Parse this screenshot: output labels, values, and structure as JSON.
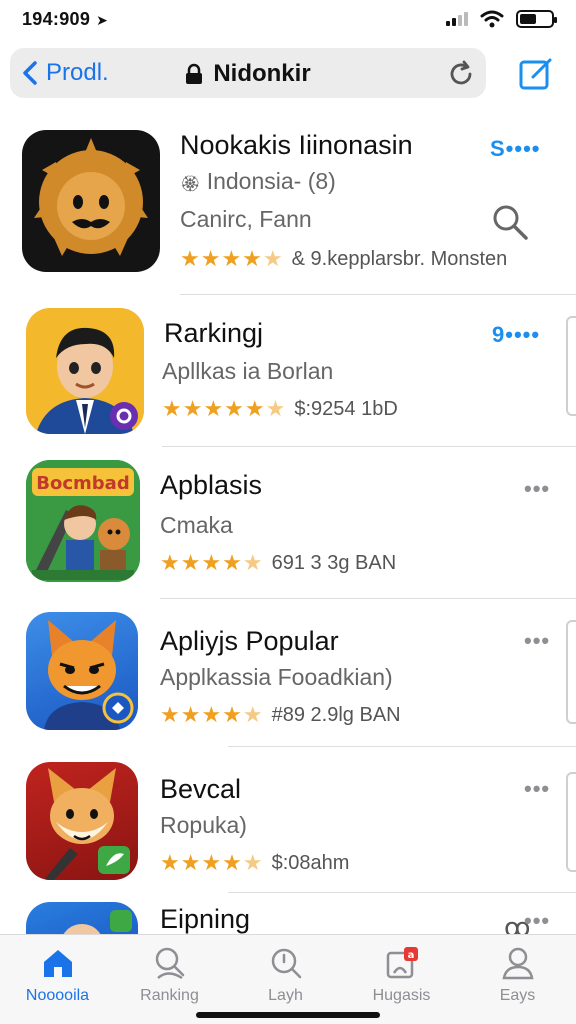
{
  "status_bar": {
    "time": "194:909",
    "location_arrow": "➤"
  },
  "nav": {
    "back_label": "Prodl.",
    "title": "Nidonkir",
    "lock_icon": "🔒"
  },
  "apps": [
    {
      "name": "Nookakis Iiinonasin",
      "subtitle": "Indonsia- (8)",
      "subtitle2": "Canirc, Fann",
      "rating_text": "& 9.kepplarsbr. Monsten",
      "more": "S••••"
    },
    {
      "name": "Rarkingj",
      "subtitle": "Apllkas ia Borlan",
      "rating_text": "$:9254 1bD",
      "more": "9••••"
    },
    {
      "name": "Apblasis",
      "subtitle": "Cmaka",
      "rating_text": "691 3 3g BAN",
      "more": "•••"
    },
    {
      "name": "Apliyjs Popular",
      "subtitle": "Applkassia Fooadkian)",
      "rating_text": "#89 2.9lg BAN",
      "more": "•••"
    },
    {
      "name": "Bevcal",
      "subtitle": "Ropuka)",
      "rating_text": "$:08ahm",
      "more": "•••",
      "extra": "ꝏ"
    },
    {
      "name": "Eipning",
      "more": "•••"
    }
  ],
  "icon_art": {
    "app3_banner": "Bocmbad"
  },
  "tabs": [
    {
      "label": "Nooooila",
      "icon": "home-icon",
      "active": true
    },
    {
      "label": "Ranking",
      "icon": "search-icon",
      "active": false
    },
    {
      "label": "Layh",
      "icon": "magnifier-icon",
      "active": false
    },
    {
      "label": "Hugasis",
      "icon": "badge-icon",
      "active": false
    },
    {
      "label": "Eays",
      "icon": "person-icon",
      "active": false
    }
  ],
  "colors": {
    "accent": "#1a73e8",
    "star": "#f0a020",
    "badge": "#e53935"
  }
}
